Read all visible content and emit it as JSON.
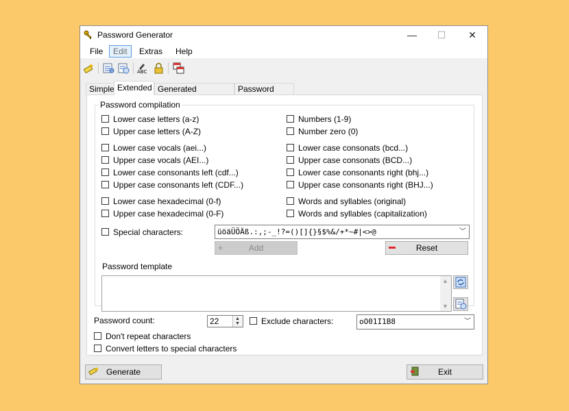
{
  "window": {
    "title": "Password Generator",
    "controls": {
      "minimize": "—",
      "maximize": "☐",
      "close": "✕"
    }
  },
  "menu": [
    "File",
    "Edit",
    "Extras",
    "Help"
  ],
  "toolbar_icons": [
    "wand-icon",
    "list-icon",
    "list-refresh-icon",
    "spell-check-icon",
    "lock-icon",
    "copy-windows-icon"
  ],
  "tabs": [
    "Simple",
    "Extended",
    "Generated passwords",
    "Password check"
  ],
  "compilation": {
    "label": "Password compilation",
    "left": [
      "Lower case letters (a-z)",
      "Upper case letters (A-Z)",
      "Lower case vocals (aei...)",
      "Upper case vocals (AEI...)",
      "Lower case consonants left (cdf...)",
      "Upper case consonants left (CDF...)",
      "Lower case hexadecimal (0-f)",
      "Upper case hexadecimal (0-F)"
    ],
    "right": [
      "Numbers (1-9)",
      "Number zero (0)",
      "Lower case consonats (bcd...)",
      "Upper case consonats (BCD...)",
      "Lower case consonants right (bhj...)",
      "Upper case consonants right (BHJ...)",
      "Words and syllables (original)",
      "Words and syllables (capitalization)"
    ],
    "special_label": "Special characters:",
    "special_value": "üöäÜÖÄß.:,;-_!?=()[]{}§$%&/+*~#|<>@",
    "add_label": "Add",
    "reset_label": "Reset"
  },
  "template": {
    "label": "Password template",
    "value": ""
  },
  "options": {
    "count_label": "Password count:",
    "count_value": "22",
    "exclude_label": "Exclude characters:",
    "exclude_value": "oO01I1B8",
    "no_repeat_label": "Don't repeat characters",
    "convert_label": "Convert letters to special characters"
  },
  "buttons": {
    "generate": "Generate",
    "exit": "Exit"
  },
  "colors": {
    "background": "#fbc96a",
    "menu_active": "#e5f1fb",
    "reset_icon": "#e0262d"
  }
}
